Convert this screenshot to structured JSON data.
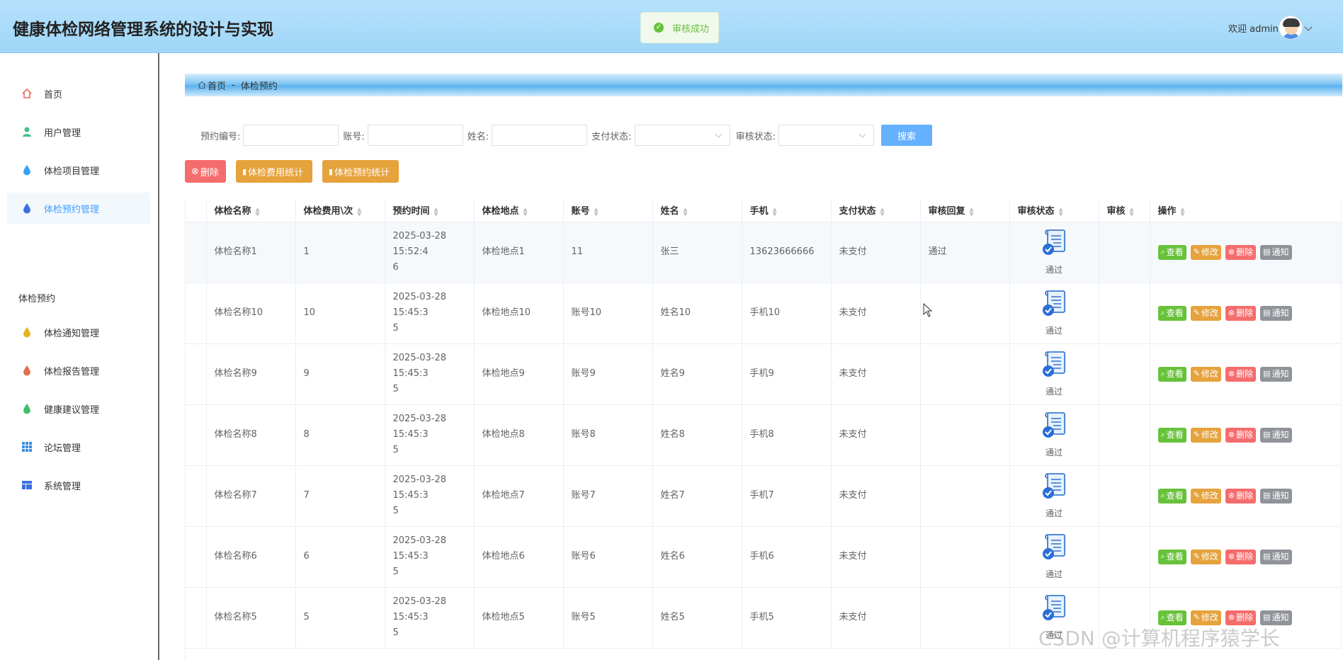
{
  "header": {
    "title": "健康体检网络管理系统的设计与实现",
    "toast": "审核成功",
    "welcome": "欢迎 admin"
  },
  "sidebar": {
    "items": [
      {
        "label": "首页",
        "icon": "home-icon",
        "color": "#e86b5a"
      },
      {
        "label": "用户管理",
        "icon": "user-icon",
        "color": "#3fbf8a"
      },
      {
        "label": "体检项目管理",
        "icon": "drop-icon",
        "color": "#36a3f7"
      },
      {
        "label": "体检预约管理",
        "icon": "drop-icon",
        "color": "#3c6fe0"
      },
      {
        "label": "体检通知管理",
        "icon": "drop-icon",
        "color": "#e6b422"
      },
      {
        "label": "体检报告管理",
        "icon": "drop-icon",
        "color": "#e0704f"
      },
      {
        "label": "健康建议管理",
        "icon": "drop-icon",
        "color": "#3fbf6a"
      },
      {
        "label": "论坛管理",
        "icon": "grid-icon",
        "color": "#3c8de0"
      },
      {
        "label": "系统管理",
        "icon": "layout-icon",
        "color": "#3c6fe0"
      }
    ],
    "group_label": "体检预约"
  },
  "breadcrumb": {
    "home": "首页",
    "sep": "-",
    "current": "体检预约"
  },
  "search": {
    "fields": [
      {
        "label": "预约编号:",
        "type": "input"
      },
      {
        "label": "账号:",
        "type": "input"
      },
      {
        "label": "姓名:",
        "type": "input"
      },
      {
        "label": "支付状态:",
        "type": "select"
      },
      {
        "label": "审核状态:",
        "type": "select"
      }
    ],
    "button": "搜索"
  },
  "toolbar": {
    "delete": "删除",
    "fee_stats": "体检费用统计",
    "booking_stats": "体检预约统计"
  },
  "table": {
    "columns": [
      "体检名称",
      "体检费用\\次",
      "预约时间",
      "体检地点",
      "账号",
      "姓名",
      "手机",
      "支付状态",
      "审核回复",
      "审核状态",
      "审核",
      "操作"
    ],
    "ops": [
      "查看",
      "修改",
      "删除",
      "通知"
    ],
    "rows": [
      {
        "name": "体检名称1",
        "fee": "1",
        "time1": "2025-03-28 15:52:4",
        "time2": "6",
        "place": "体检地点1",
        "account": "11",
        "person": "张三",
        "phone": "13623666666",
        "pay": "未支付",
        "reply": "通过",
        "status": "通过"
      },
      {
        "name": "体检名称10",
        "fee": "10",
        "time1": "2025-03-28 15:45:3",
        "time2": "5",
        "place": "体检地点10",
        "account": "账号10",
        "person": "姓名10",
        "phone": "手机10",
        "pay": "未支付",
        "reply": "",
        "status": "通过"
      },
      {
        "name": "体检名称9",
        "fee": "9",
        "time1": "2025-03-28 15:45:3",
        "time2": "5",
        "place": "体检地点9",
        "account": "账号9",
        "person": "姓名9",
        "phone": "手机9",
        "pay": "未支付",
        "reply": "",
        "status": "通过"
      },
      {
        "name": "体检名称8",
        "fee": "8",
        "time1": "2025-03-28 15:45:3",
        "time2": "5",
        "place": "体检地点8",
        "account": "账号8",
        "person": "姓名8",
        "phone": "手机8",
        "pay": "未支付",
        "reply": "",
        "status": "通过"
      },
      {
        "name": "体检名称7",
        "fee": "7",
        "time1": "2025-03-28 15:45:3",
        "time2": "5",
        "place": "体检地点7",
        "account": "账号7",
        "person": "姓名7",
        "phone": "手机7",
        "pay": "未支付",
        "reply": "",
        "status": "通过"
      },
      {
        "name": "体检名称6",
        "fee": "6",
        "time1": "2025-03-28 15:45:3",
        "time2": "5",
        "place": "体检地点6",
        "account": "账号6",
        "person": "姓名6",
        "phone": "手机6",
        "pay": "未支付",
        "reply": "",
        "status": "通过"
      },
      {
        "name": "体检名称5",
        "fee": "5",
        "time1": "2025-03-28 15:45:3",
        "time2": "5",
        "place": "体检地点5",
        "account": "账号5",
        "person": "姓名5",
        "phone": "手机5",
        "pay": "未支付",
        "reply": "",
        "status": "通过"
      }
    ]
  },
  "watermark": "CSDN @计算机程序猿学长"
}
